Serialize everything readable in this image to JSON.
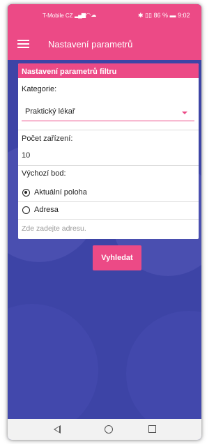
{
  "status_bar": {
    "carrier": "T-Mobile CZ",
    "battery": "86 %",
    "time": "9:02"
  },
  "app_bar": {
    "title": "Nastavení parametrů"
  },
  "panel": {
    "header": "Nastavení parametrů filtru",
    "category_label": "Kategorie:",
    "category_value": "Praktický lékař",
    "count_label": "Počet zařízení:",
    "count_value": "10",
    "start_label": "Výchozí bod:",
    "radio_current": "Aktuální poloha",
    "radio_address": "Adresa",
    "address_placeholder": "Zde zadejte adresu.",
    "selected_radio": "current"
  },
  "search_button": "Vyhledat",
  "colors": {
    "accent": "#ec4a86",
    "background": "#3d44a6"
  },
  "icons": {
    "menu": "hamburger-menu-icon",
    "dropdown": "caret-down-icon"
  }
}
